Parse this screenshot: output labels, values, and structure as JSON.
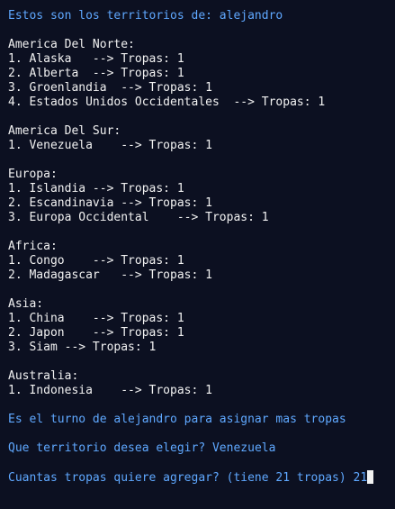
{
  "window": {
    "colors": {
      "background": "#0c1021",
      "text": "#f2f2f2",
      "prompt": "#5fa8ff"
    }
  },
  "header": {
    "text": "Estos son los territorios de: alejandro"
  },
  "continents": [
    {
      "name": "America Del Norte:",
      "territories": [
        "1. Alaska   --> Tropas: 1",
        "2. Alberta  --> Tropas: 1",
        "3. Groenlandia  --> Tropas: 1",
        "4. Estados Unidos Occidentales  --> Tropas: 1"
      ]
    },
    {
      "name": "America Del Sur:",
      "territories": [
        "1. Venezuela    --> Tropas: 1"
      ]
    },
    {
      "name": "Europa:",
      "territories": [
        "1. Islandia --> Tropas: 1",
        "2. Escandinavia --> Tropas: 1",
        "3. Europa Occidental    --> Tropas: 1"
      ]
    },
    {
      "name": "Africa:",
      "territories": [
        "1. Congo    --> Tropas: 1",
        "2. Madagascar   --> Tropas: 1"
      ]
    },
    {
      "name": "Asia:",
      "territories": [
        "1. China    --> Tropas: 1",
        "2. Japon    --> Tropas: 1",
        "3. Siam --> Tropas: 1"
      ]
    },
    {
      "name": "Australia:",
      "territories": [
        "1. Indonesia    --> Tropas: 1"
      ]
    }
  ],
  "prompts": {
    "turn": "Es el turno de alejandro para asignar mas tropas",
    "territory_question": "Que territorio desea elegir? ",
    "territory_answer": "Venezuela",
    "troops_question": "Cuantas tropas quiere agregar? (tiene 21 tropas) ",
    "troops_answer": "21"
  }
}
